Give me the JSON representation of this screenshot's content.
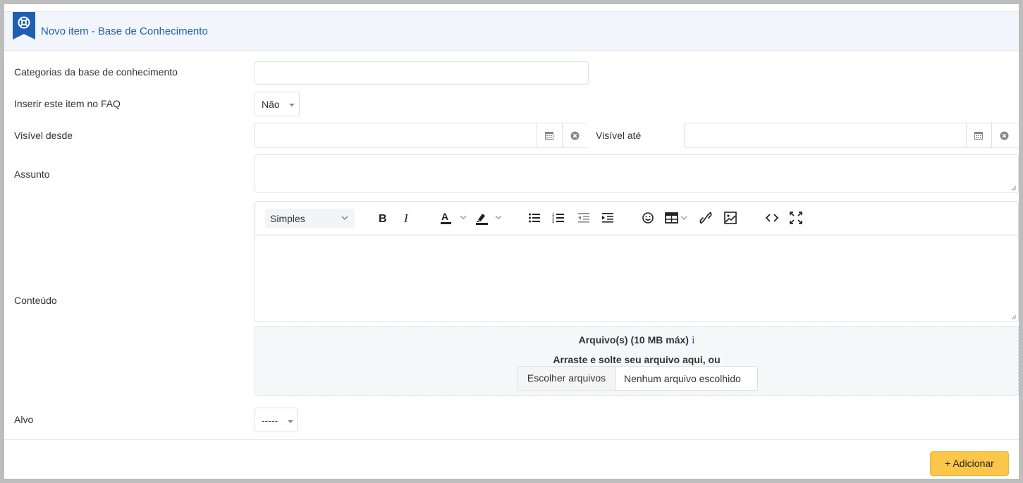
{
  "header": {
    "title": "Novo item - Base de Conhecimento",
    "icon": "lifebuoy-icon",
    "accent_color": "#1e5fb3"
  },
  "form": {
    "categories_label": "Categorias da base de conhecimento",
    "categories_value": "",
    "faq_label": "Inserir este item no FAQ",
    "faq_value": "Não",
    "visible_from_label": "Visível desde",
    "visible_from_value": "",
    "visible_until_label": "Visível até",
    "visible_until_value": "",
    "subject_label": "Assunto",
    "subject_value": "",
    "content_label": "Conteúdo",
    "target_label": "Alvo",
    "target_value": "-----"
  },
  "editor": {
    "format_select": "Simples",
    "tools": [
      "bold-icon",
      "italic-icon",
      "text-color-icon",
      "highlight-icon",
      "bullet-list-icon",
      "numbered-list-icon",
      "outdent-icon",
      "indent-icon",
      "emoji-icon",
      "table-icon",
      "link-icon",
      "image-icon",
      "code-icon",
      "fullscreen-icon"
    ],
    "content": ""
  },
  "upload": {
    "title": "Arquivo(s) (10 MB máx)",
    "info_icon": "i",
    "instruction": "Arraste e solte seu arquivo aqui, ou",
    "choose_button": "Escolher arquivos",
    "status": "Nenhum arquivo escolhido"
  },
  "actions": {
    "add_button": "+ Adicionar",
    "add_button_color": "#fcc64b"
  }
}
